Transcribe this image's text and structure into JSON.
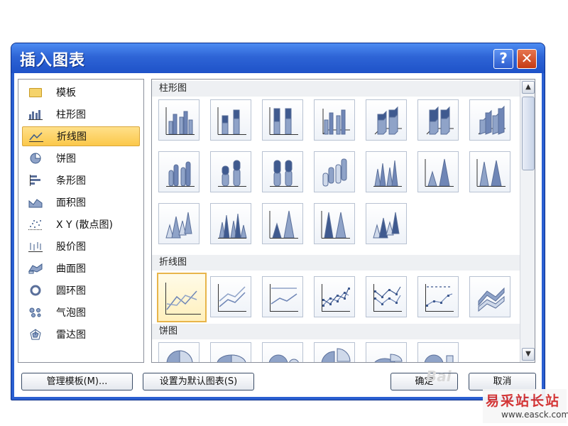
{
  "window": {
    "title": "插入图表",
    "help_label": "?",
    "close_label": "✕"
  },
  "categories": [
    {
      "label": "模板",
      "icon": "folder-icon",
      "selected": false
    },
    {
      "label": "柱形图",
      "icon": "column-chart-icon",
      "selected": false
    },
    {
      "label": "折线图",
      "icon": "line-chart-icon",
      "selected": true
    },
    {
      "label": "饼图",
      "icon": "pie-chart-icon",
      "selected": false
    },
    {
      "label": "条形图",
      "icon": "bar-chart-icon",
      "selected": false
    },
    {
      "label": "面积图",
      "icon": "area-chart-icon",
      "selected": false
    },
    {
      "label": "X Y (散点图)",
      "icon": "scatter-chart-icon",
      "selected": false
    },
    {
      "label": "股价图",
      "icon": "stock-chart-icon",
      "selected": false
    },
    {
      "label": "曲面图",
      "icon": "surface-chart-icon",
      "selected": false
    },
    {
      "label": "圆环图",
      "icon": "doughnut-chart-icon",
      "selected": false
    },
    {
      "label": "气泡图",
      "icon": "bubble-chart-icon",
      "selected": false
    },
    {
      "label": "雷达图",
      "icon": "radar-chart-icon",
      "selected": false
    }
  ],
  "sections": {
    "column": {
      "title": "柱形图"
    },
    "line": {
      "title": "折线图"
    },
    "pie": {
      "title": "饼图"
    }
  },
  "buttons": {
    "manage_templates": "管理模板(M)...",
    "set_default": "设置为默认图表(S)",
    "ok": "确定",
    "cancel": "取消"
  },
  "scrollbar": {
    "up": "▲",
    "down": "▼"
  },
  "watermark": {
    "title": "易采站长站",
    "url": "www.easck.com",
    "baidu": "Bai"
  },
  "colors": {
    "accent": "#2a5fd1",
    "selected": "#fbc84a",
    "chart_fill": "#6f86b6"
  }
}
